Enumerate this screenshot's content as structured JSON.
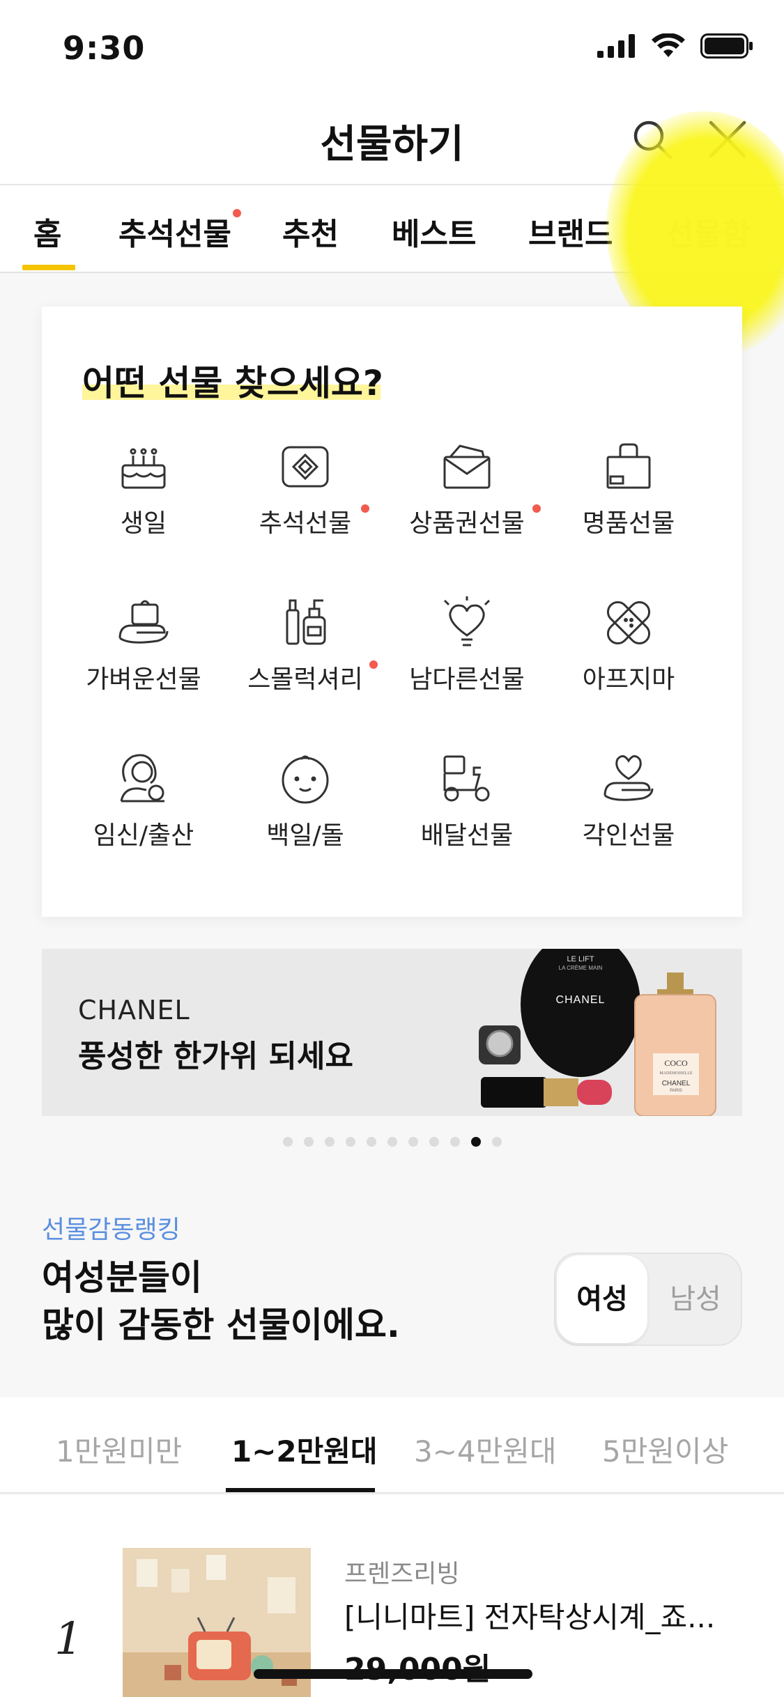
{
  "status": {
    "time": "9:30"
  },
  "header": {
    "title": "선물하기"
  },
  "tabs": [
    {
      "label": "홈",
      "active": true,
      "dot": false
    },
    {
      "label": "추석선물",
      "active": false,
      "dot": true
    },
    {
      "label": "추천",
      "active": false,
      "dot": false
    },
    {
      "label": "베스트",
      "active": false,
      "dot": false
    },
    {
      "label": "브랜드",
      "active": false,
      "dot": false
    },
    {
      "label": "선물함",
      "active": false,
      "dot": false
    }
  ],
  "category": {
    "title": "어떤 선물 찾으세요?",
    "items": [
      {
        "label": "생일",
        "icon": "birthday-cake-icon",
        "dot": false
      },
      {
        "label": "추석선물",
        "icon": "gift-box-icon",
        "dot": true
      },
      {
        "label": "상품권선물",
        "icon": "envelope-icon",
        "dot": true
      },
      {
        "label": "명품선물",
        "icon": "shopping-bag-icon",
        "dot": false
      },
      {
        "label": "가벼운선물",
        "icon": "hand-gift-icon",
        "dot": false
      },
      {
        "label": "스몰럭셔리",
        "icon": "cosmetics-icon",
        "dot": true
      },
      {
        "label": "남다른선물",
        "icon": "heart-bulb-icon",
        "dot": false
      },
      {
        "label": "아프지마",
        "icon": "bandage-icon",
        "dot": false
      },
      {
        "label": "임신/출산",
        "icon": "mother-baby-icon",
        "dot": false
      },
      {
        "label": "백일/돌",
        "icon": "baby-face-icon",
        "dot": false
      },
      {
        "label": "배달선물",
        "icon": "delivery-scooter-icon",
        "dot": false
      },
      {
        "label": "각인선물",
        "icon": "hand-heart-icon",
        "dot": false
      }
    ]
  },
  "banner": {
    "brand": "CHANEL",
    "title": "풍성한 한가위 되세요",
    "product_texts": [
      "LE LIFT",
      "LA CRÈME MAIN",
      "CHANEL",
      "COCO",
      "MADEMOISELLE",
      "CHANEL",
      "PARIS"
    ],
    "page_count": 11,
    "active_index": 9
  },
  "ranking": {
    "label": "선물감동랭킹",
    "title_line1": "여성분들이",
    "title_line2": "많이 감동한 선물이에요.",
    "toggle_on": "여성",
    "toggle_off": "남성"
  },
  "price_tabs": [
    "1만원미만",
    "1~2만원대",
    "3~4만원대",
    "5만원이상"
  ],
  "price_tab_active": 1,
  "product": {
    "rank": "1",
    "brand": "프렌즈리빙",
    "name": "[니니마트] 전자탁상시계_죠...",
    "price": "29,000원"
  },
  "colors": {
    "accent_yellow": "#f5c400",
    "dot_red": "#f25b4e",
    "link_blue": "#5a8fe0",
    "highlight": "#fff59a"
  }
}
